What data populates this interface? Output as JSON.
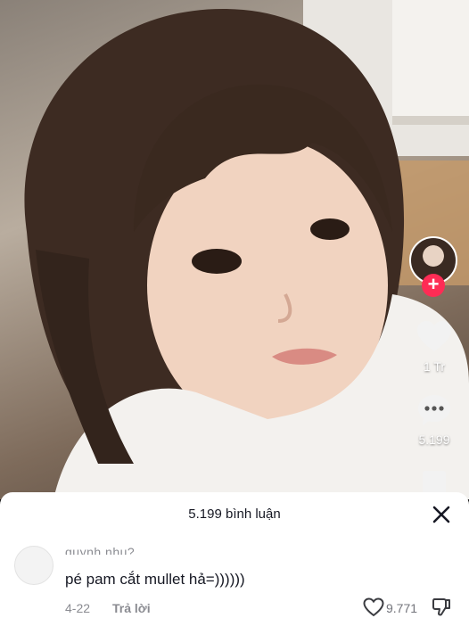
{
  "video": {
    "description_icon": "video-frame"
  },
  "rail": {
    "follow_symbol": "+",
    "like_count": "1 Tr",
    "comment_count": "5.199"
  },
  "comments": {
    "header": "5.199 bình luận",
    "close_symbol": "✕",
    "items": [
      {
        "username": "quynh nhu?",
        "text": "pé pam cắt mullet hả=))))))",
        "date": "4-22",
        "reply_label": "Trả lời",
        "like_count": "9.771"
      }
    ]
  },
  "colors": {
    "accent": "#fe2c55",
    "text_primary": "#161823",
    "text_secondary": "#8a8b91"
  }
}
